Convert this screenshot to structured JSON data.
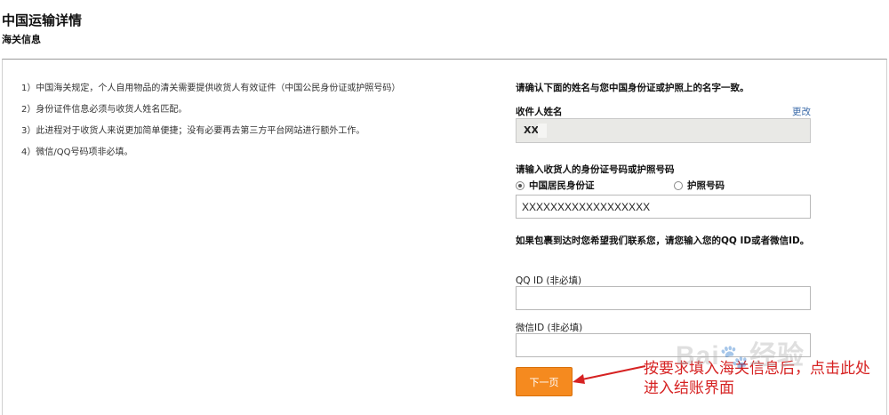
{
  "header": {
    "title": "中国运输详情",
    "subtitle": "海关信息"
  },
  "notes": [
    "1）中国海关规定，个人自用物品的清关需要提供收货人有效证件（中国公民身份证或护照号码）",
    "2）身份证件信息必须与收货人姓名匹配。",
    "3）此进程对于收货人来说更加简单便捷；没有必要再去第三方平台网站进行额外工作。",
    "4）微信/QQ号码项非必填。"
  ],
  "form": {
    "confirm_text": "请确认下面的姓名与您中国身份证或护照上的名字一致。",
    "name_label": "收件人姓名",
    "edit_label": "更改",
    "name_value": "XX",
    "id_label": "请输入收货人的身份证号码或护照号码",
    "radio_id_card": "中国居民身份证",
    "radio_passport": "护照号码",
    "id_value": "XXXXXXXXXXXXXXXXXX",
    "contact_text": "如果包裹到达时您希望我们联系您，请您输入您的QQ ID或者微信ID。",
    "qq_label": "QQ ID (非必填)",
    "qq_value": "",
    "wechat_label": "微信ID (非必填)",
    "wechat_value": "",
    "next_button": "下一页"
  },
  "annotation": {
    "text": "按要求填入海关信息后，点击此处进入结账界面",
    "color": "#d62222"
  },
  "watermark": {
    "text": "Bai",
    "text2": "经验"
  },
  "colors": {
    "accent": "#f58a1f",
    "link": "#3a6aa8"
  }
}
